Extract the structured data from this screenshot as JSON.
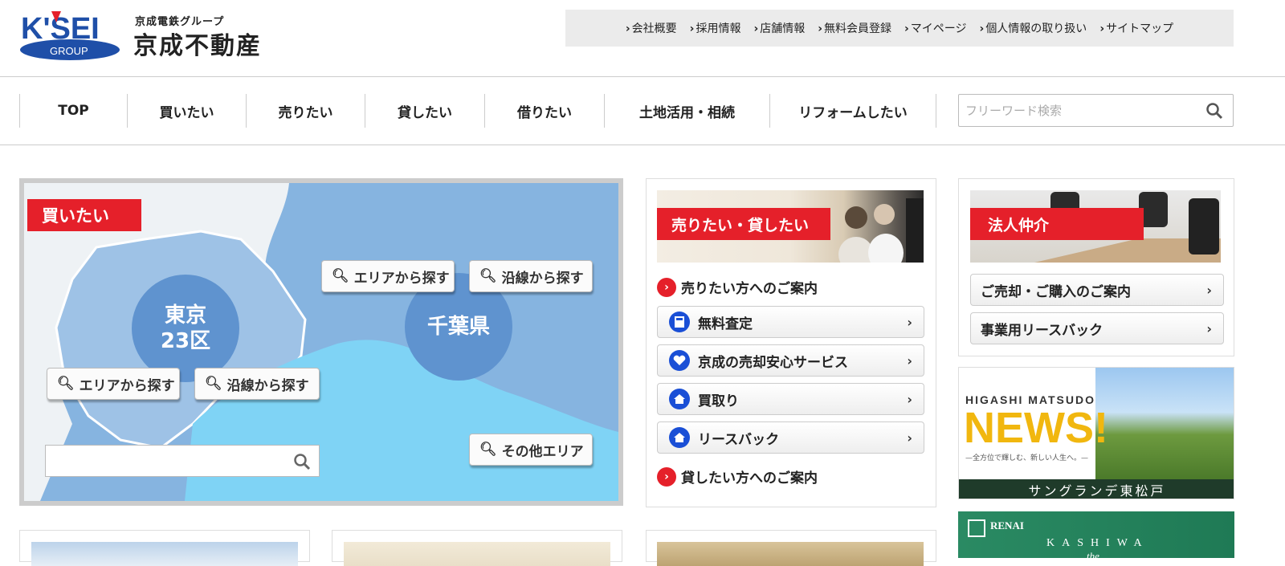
{
  "brand": {
    "logo_top": "K'SEI",
    "logo_bottom": "GROUP",
    "small": "京成電鉄グループ",
    "name": "京成不動産"
  },
  "util_links": [
    "会社概要",
    "採用情報",
    "店舗情報",
    "無料会員登録",
    "マイページ",
    "個人情報の取り扱い",
    "サイトマップ"
  ],
  "gnav": [
    "TOP",
    "買いたい",
    "売りたい",
    "貸したい",
    "借りたい",
    "土地活用・相続",
    "リフォームしたい"
  ],
  "search": {
    "placeholder": "フリーワード検索"
  },
  "buy": {
    "tag": "買いたい",
    "tokyo_label_1": "東京",
    "tokyo_label_2": "23区",
    "chiba_label": "千葉県",
    "area_search": "エリアから探す",
    "line_search": "沿線から探す",
    "other_area": "その他エリア"
  },
  "sell": {
    "tag": "売りたい・貸したい",
    "guide_sell": "売りたい方へのご案内",
    "items": [
      "無料査定",
      "京成の売却安心サービス",
      "買取り",
      "リースバック"
    ],
    "guide_rent": "貸したい方へのご案内"
  },
  "corp": {
    "tag": "法人仲介",
    "items": [
      "ご売却・ご購入のご案内",
      "事業用リースバック"
    ]
  },
  "banners": {
    "news_top": "HIGASHI MATSUDO",
    "news_big": "NEWS!",
    "news_sub": "—全方位で輝しむ、新しい人生へ。—",
    "news_caption": "サングランデ東松戸",
    "renai_brand": "RENAI",
    "renai_title": "KASHIWA",
    "renai_script": "the"
  },
  "colors": {
    "accent": "#e5202a",
    "blue": "#1a4fd6",
    "map_sea": "#86b4e0",
    "map_tokyo": "#9ec2e6",
    "map_bay": "#7fd3f5"
  }
}
